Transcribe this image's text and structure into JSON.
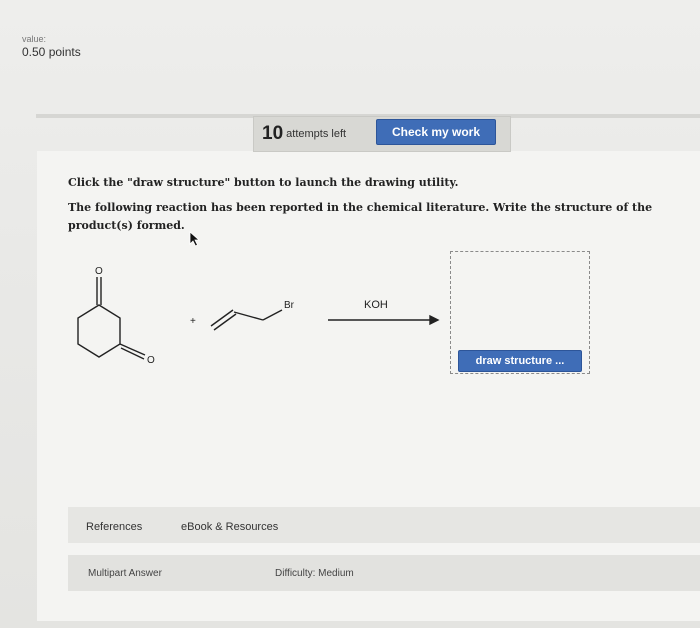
{
  "header": {
    "value_label": "value:",
    "points": "0.50 points"
  },
  "attempts": {
    "count": "10",
    "label": "attempts left",
    "check_button": "Check my work"
  },
  "instructions": {
    "line1": "Click the \"draw structure\" button to launch the drawing utility.",
    "line2": "The following reaction has been reported in the chemical literature. Write the structure of the product(s) formed."
  },
  "reaction": {
    "oxygen_top": "O",
    "oxygen_ring": "O",
    "plus": "+",
    "bromine": "Br",
    "reagent": "KOH"
  },
  "draw_button": "draw structure ...",
  "tabs": {
    "references": "References",
    "ebook": "eBook & Resources"
  },
  "footer": {
    "type": "Multipart Answer",
    "difficulty": "Difficulty: Medium"
  }
}
